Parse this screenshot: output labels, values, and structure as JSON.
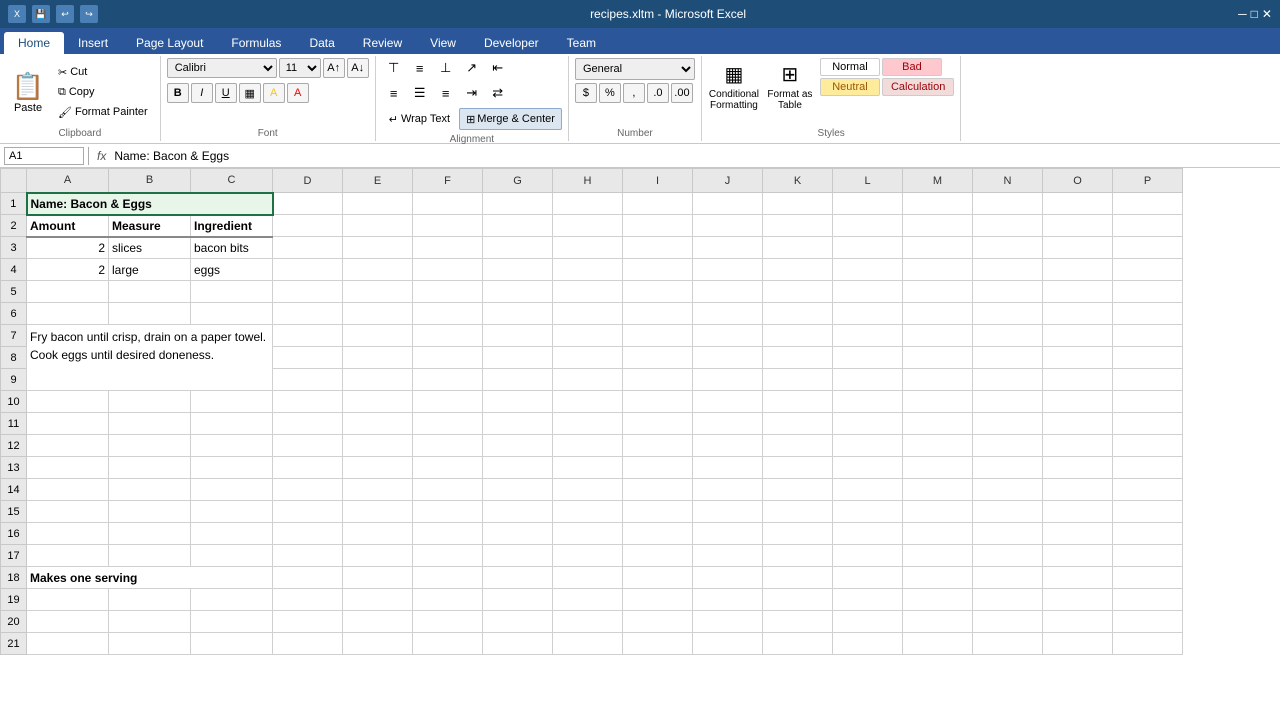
{
  "titleBar": {
    "title": "recipes.xltm - Microsoft Excel"
  },
  "tabs": [
    {
      "label": "Home",
      "active": true
    },
    {
      "label": "Insert",
      "active": false
    },
    {
      "label": "Page Layout",
      "active": false
    },
    {
      "label": "Formulas",
      "active": false
    },
    {
      "label": "Data",
      "active": false
    },
    {
      "label": "Review",
      "active": false
    },
    {
      "label": "View",
      "active": false
    },
    {
      "label": "Developer",
      "active": false
    },
    {
      "label": "Team",
      "active": false
    }
  ],
  "ribbon": {
    "clipboard": {
      "label": "Clipboard",
      "paste": "Paste",
      "cut": "Cut",
      "copy": "Copy",
      "formatPainter": "Format Painter"
    },
    "font": {
      "label": "Font",
      "fontName": "Calibri",
      "fontSize": "11",
      "bold": "B",
      "italic": "I",
      "underline": "U"
    },
    "alignment": {
      "label": "Alignment",
      "wrapText": "Wrap Text",
      "mergeCenter": "Merge & Center"
    },
    "number": {
      "label": "Number",
      "format": "General"
    },
    "styles": {
      "label": "Styles",
      "normal": "Normal",
      "bad": "Bad",
      "neutral": "Neutral",
      "calculation": "Calculation"
    }
  },
  "formulaBar": {
    "cellRef": "A1",
    "formula": "Name: Bacon & Eggs"
  },
  "columns": [
    "A",
    "B",
    "C",
    "D",
    "E",
    "F",
    "G",
    "H",
    "I",
    "J",
    "K",
    "L",
    "M",
    "N",
    "O",
    "P"
  ],
  "rows": [
    1,
    2,
    3,
    4,
    5,
    6,
    7,
    8,
    9,
    10,
    11,
    12,
    13,
    14,
    15,
    16,
    17,
    18,
    19,
    20,
    21
  ],
  "cells": {
    "A1": {
      "value": "Name: Bacon & Eggs",
      "bold": true,
      "selected": true
    },
    "A2": {
      "value": "Amount",
      "bold": true
    },
    "B2": {
      "value": "Measure",
      "bold": true
    },
    "C2": {
      "value": "Ingredient",
      "bold": true
    },
    "A3": {
      "value": "2",
      "align": "right"
    },
    "B3": {
      "value": "slices"
    },
    "C3": {
      "value": "bacon bits"
    },
    "A4": {
      "value": "2",
      "align": "right"
    },
    "B4": {
      "value": "large"
    },
    "C4": {
      "value": "eggs"
    },
    "A7": {
      "value": "Fry bacon until crisp, drain on a paper towel. Cook eggs until desired doneness.",
      "wrap": true
    },
    "A18": {
      "value": "Makes one serving",
      "bold": true
    }
  }
}
